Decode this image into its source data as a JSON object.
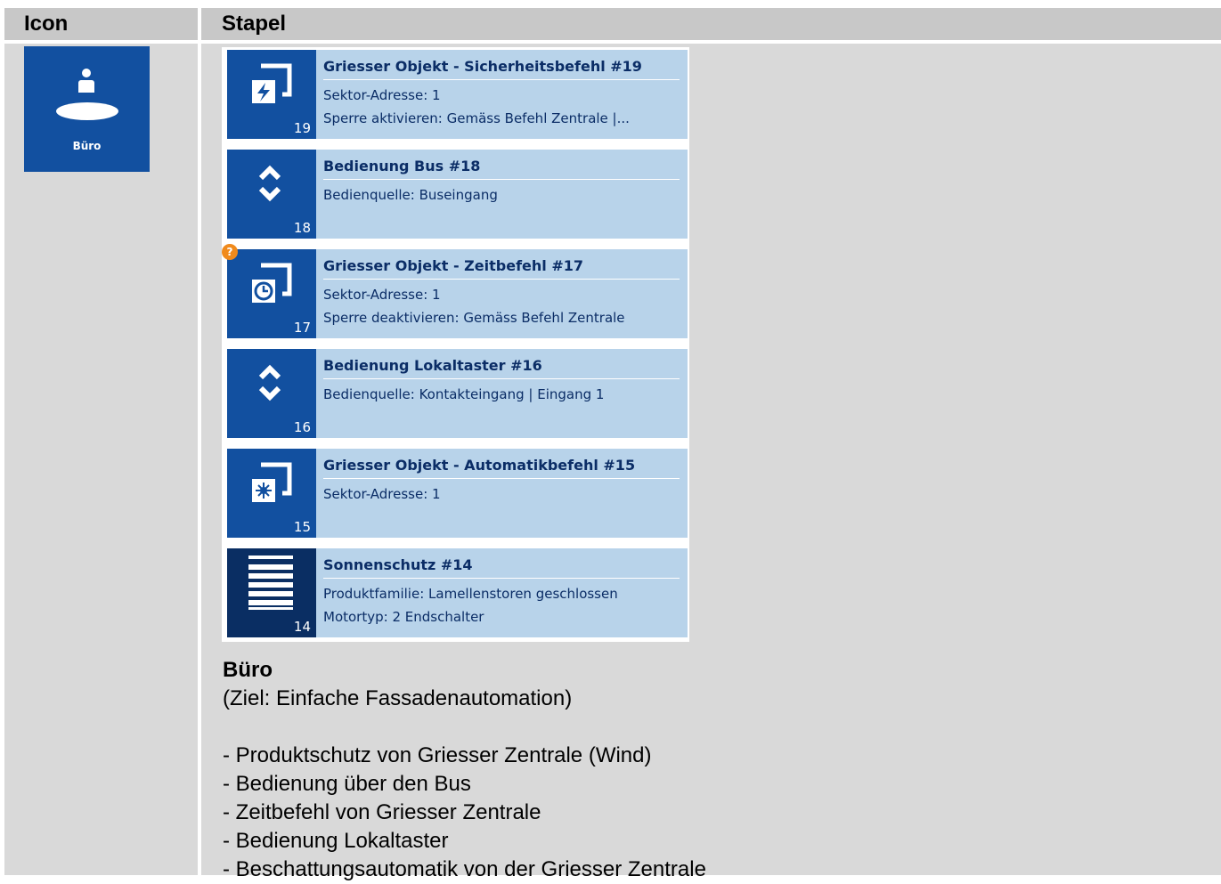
{
  "header": {
    "col_icon": "Icon",
    "col_stack": "Stapel"
  },
  "room": {
    "label": "Büro",
    "icon": "room-office-icon"
  },
  "cards": [
    {
      "num": "19",
      "title": "Griesser Objekt - Sicherheitsbefehl #19",
      "line1": "Sektor-Adresse: 1",
      "line2": "Sperre aktivieren: Gemäss Befehl Zentrale |...",
      "icon": "security-command-icon",
      "warning": ""
    },
    {
      "num": "18",
      "title": "Bedienung Bus #18",
      "line1": "Bedienquelle: Buseingang",
      "line2": "",
      "icon": "up-down-icon",
      "warning": ""
    },
    {
      "num": "17",
      "title": "Griesser Objekt - Zeitbefehl #17",
      "line1": "Sektor-Adresse: 1",
      "line2": "Sperre deaktivieren: Gemäss Befehl Zentrale",
      "icon": "time-command-icon",
      "warning": "?"
    },
    {
      "num": "16",
      "title": "Bedienung Lokaltaster #16",
      "line1": "Bedienquelle: Kontakteingang | Eingang 1",
      "line2": "",
      "icon": "up-down-icon",
      "warning": ""
    },
    {
      "num": "15",
      "title": "Griesser Objekt - Automatikbefehl #15",
      "line1": "Sektor-Adresse: 1",
      "line2": "",
      "icon": "automatic-command-icon",
      "warning": ""
    },
    {
      "num": "14",
      "title": "Sonnenschutz #14",
      "line1": "Produktfamilie: Lamellenstoren geschlossen",
      "line2": "Motortyp: 2 Endschalter",
      "icon": "sunshade-icon",
      "warning": ""
    }
  ],
  "description": {
    "name": "Büro",
    "goal": "(Ziel: Einfache Fassadenautomation)",
    "items": [
      "- Produktschutz von Griesser Zentrale (Wind)",
      "- Bedienung über den Bus",
      "- Zeitbefehl von Griesser Zentrale",
      "- Bedienung Lokaltaster",
      "- Beschattungsautomatik von der Griesser Zentrale"
    ]
  }
}
